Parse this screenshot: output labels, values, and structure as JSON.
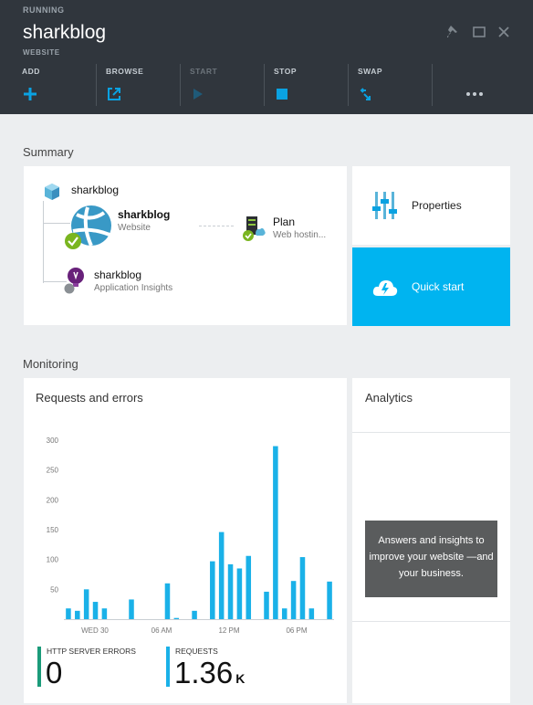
{
  "header": {
    "status": "RUNNING",
    "title": "sharkblog",
    "subtitle": "WEBSITE",
    "commands": [
      {
        "label": "ADD",
        "icon": "plus-icon",
        "enabled": true
      },
      {
        "label": "BROWSE",
        "icon": "browse-external-icon",
        "enabled": true
      },
      {
        "label": "START",
        "icon": "play-icon",
        "enabled": false
      },
      {
        "label": "STOP",
        "icon": "stop-icon",
        "enabled": true
      },
      {
        "label": "SWAP",
        "icon": "swap-icon",
        "enabled": true
      },
      {
        "label": "",
        "icon": "more-ellipsis-icon",
        "enabled": true
      }
    ]
  },
  "summary": {
    "heading": "Summary",
    "resource_group": "sharkblog",
    "website": {
      "name": "sharkblog",
      "type": "Website"
    },
    "plan": {
      "name": "Plan",
      "type": "Web hostin..."
    },
    "insights": {
      "name": "sharkblog",
      "type": "Application Insights"
    },
    "properties_label": "Properties",
    "quickstart_label": "Quick start"
  },
  "monitoring": {
    "heading": "Monitoring",
    "requests_title": "Requests and errors",
    "analytics_title": "Analytics",
    "analytics_callout": "Answers and insights to improve your website —and your business.",
    "metrics": {
      "errors_label": "HTTP SERVER ERRORS",
      "errors_value": "0",
      "requests_label": "REQUESTS",
      "requests_value": "1.36",
      "requests_unit": "K"
    }
  },
  "chart_data": {
    "type": "bar",
    "ylim": [
      0,
      300
    ],
    "yticks": [
      50,
      100,
      150,
      200,
      250,
      300
    ],
    "xtick_labels": [
      "WED 30",
      "06 AM",
      "12 PM",
      "06 PM"
    ],
    "values": [
      18,
      14,
      50,
      29,
      18,
      0,
      0,
      33,
      0,
      0,
      0,
      60,
      2,
      0,
      14,
      0,
      97,
      146,
      92,
      85,
      106,
      0,
      46,
      290,
      18,
      64,
      104,
      18,
      0,
      63
    ],
    "series_color": "#1ab1e8",
    "grid": false
  },
  "colors": {
    "accent": "#0aa2e2",
    "quickstart_bg": "#00b4f0",
    "header_bg": "#30363d",
    "status_ok": "#7ab520",
    "error_bar": "#1b9b7a"
  }
}
